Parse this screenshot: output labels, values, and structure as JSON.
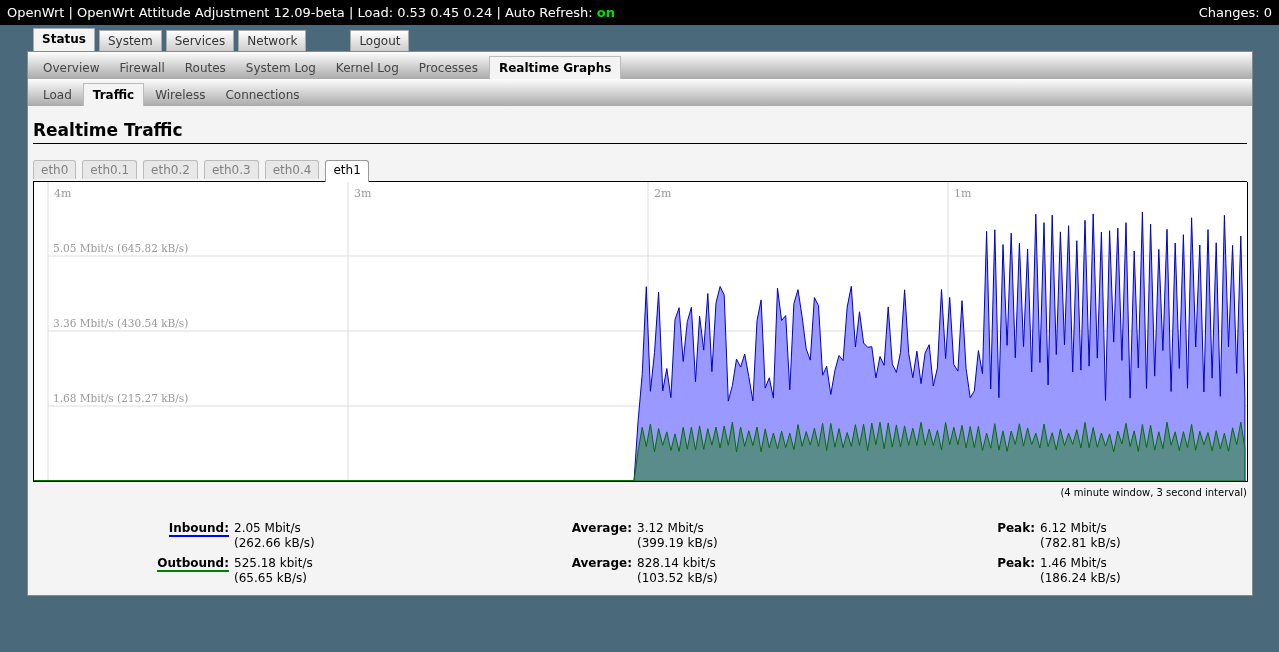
{
  "header": {
    "text": "OpenWrt | OpenWrt Attitude Adjustment 12.09-beta | Load: 0.53 0.45 0.24 | Auto Refresh:",
    "auto_refresh": "on",
    "auto_refresh_on": true,
    "changes": "Changes: 0"
  },
  "main_tabs": [
    {
      "label": "Status",
      "selected": true,
      "kind": "menu"
    },
    {
      "label": "System",
      "selected": false,
      "kind": "menu"
    },
    {
      "label": "Services",
      "selected": false,
      "kind": "menu"
    },
    {
      "label": "Network",
      "selected": false,
      "kind": "menu"
    },
    {
      "label": "Logout",
      "selected": false,
      "kind": "logout"
    }
  ],
  "sub_tabs": [
    {
      "label": "Overview",
      "selected": false
    },
    {
      "label": "Firewall",
      "selected": false
    },
    {
      "label": "Routes",
      "selected": false
    },
    {
      "label": "System Log",
      "selected": false
    },
    {
      "label": "Kernel Log",
      "selected": false
    },
    {
      "label": "Processes",
      "selected": false
    },
    {
      "label": "Realtime Graphs",
      "selected": true
    }
  ],
  "graph_tabs": [
    {
      "label": "Load",
      "selected": false
    },
    {
      "label": "Traffic",
      "selected": true
    },
    {
      "label": "Wireless",
      "selected": false
    },
    {
      "label": "Connections",
      "selected": false
    }
  ],
  "heading": "Realtime Traffic",
  "interface_tabs": [
    {
      "label": "eth0",
      "selected": false
    },
    {
      "label": "eth0.1",
      "selected": false
    },
    {
      "label": "eth0.2",
      "selected": false
    },
    {
      "label": "eth0.3",
      "selected": false
    },
    {
      "label": "eth0.4",
      "selected": false
    },
    {
      "label": "eth1",
      "selected": true
    }
  ],
  "graph": {
    "time_labels": [
      "4m",
      "3m",
      "2m",
      "1m"
    ],
    "rate_labels": [
      "5.05 Mbit/s (645.82 kB/s)",
      "3.36 Mbit/s (430.54 kB/s)",
      "1.68 Mbit/s (215.27 kB/s)"
    ],
    "caption": "(4 minute window, 3 second interval)"
  },
  "stats": [
    {
      "label": "Inbound:",
      "color": "#0000ff",
      "current": [
        "2.05 Mbit/s",
        "(262.66 kB/s)"
      ],
      "average_label": "Average:",
      "average": [
        "3.12 Mbit/s",
        "(399.19 kB/s)"
      ],
      "peak_label": "Peak:",
      "peak": [
        "6.12 Mbit/s",
        "(782.81 kB/s)"
      ]
    },
    {
      "label": "Outbound:",
      "color": "#008000",
      "current": [
        "525.18 kbit/s",
        "(65.65 kB/s)"
      ],
      "average_label": "Average:",
      "average": [
        "828.14 kbit/s",
        "(103.52 kB/s)"
      ],
      "peak_label": "Peak:",
      "peak": [
        "1.46 Mbit/s",
        "(186.24 kB/s)"
      ]
    }
  ]
}
